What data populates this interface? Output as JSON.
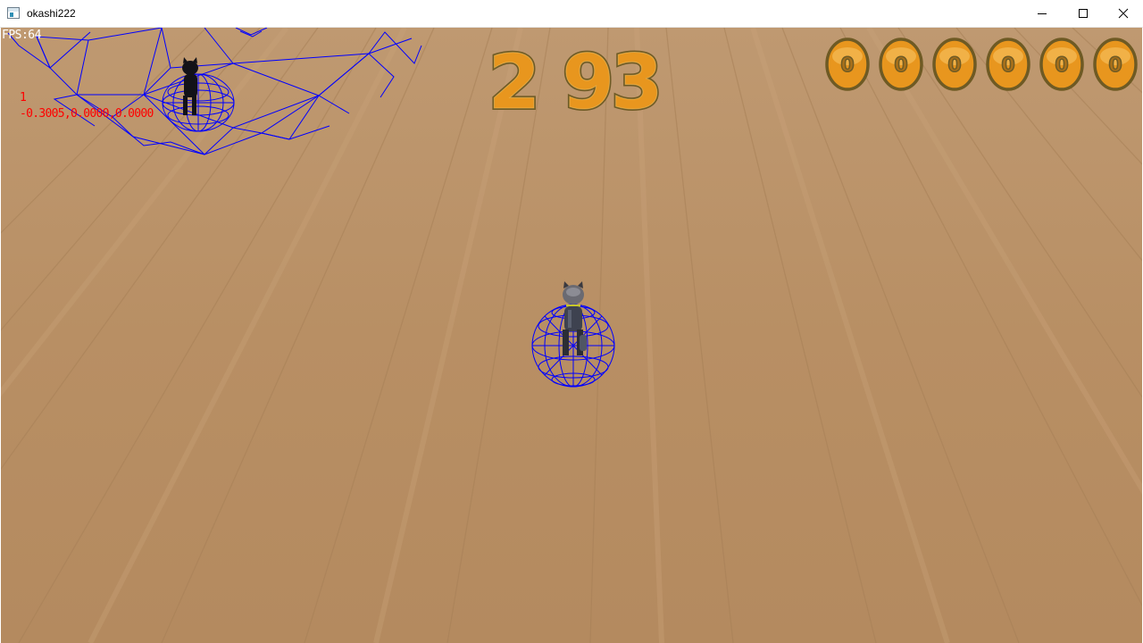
{
  "window": {
    "title": "okashi222",
    "controls": {
      "minimize_icon": "minimize-icon",
      "maximize_icon": "maximize-icon",
      "close_icon": "close-icon"
    }
  },
  "hud": {
    "fps": "FPS:64",
    "debug_count": "1",
    "debug_position": "-0.3005,0.0000,0.0000",
    "timer_minutes": "2",
    "timer_seconds": "93",
    "score_digits": [
      "0",
      "0",
      "0",
      "0",
      "0",
      "0"
    ]
  },
  "colors": {
    "floor": "#b88f64",
    "floor_light": "#c9a57d",
    "floor_dark": "#a47c52",
    "wireframe": "#0000ff",
    "debug_text": "#ff0000",
    "digit_fill": "#e8961e",
    "digit_highlight": "#f7c96a",
    "digit_outline": "#6e5a24"
  }
}
